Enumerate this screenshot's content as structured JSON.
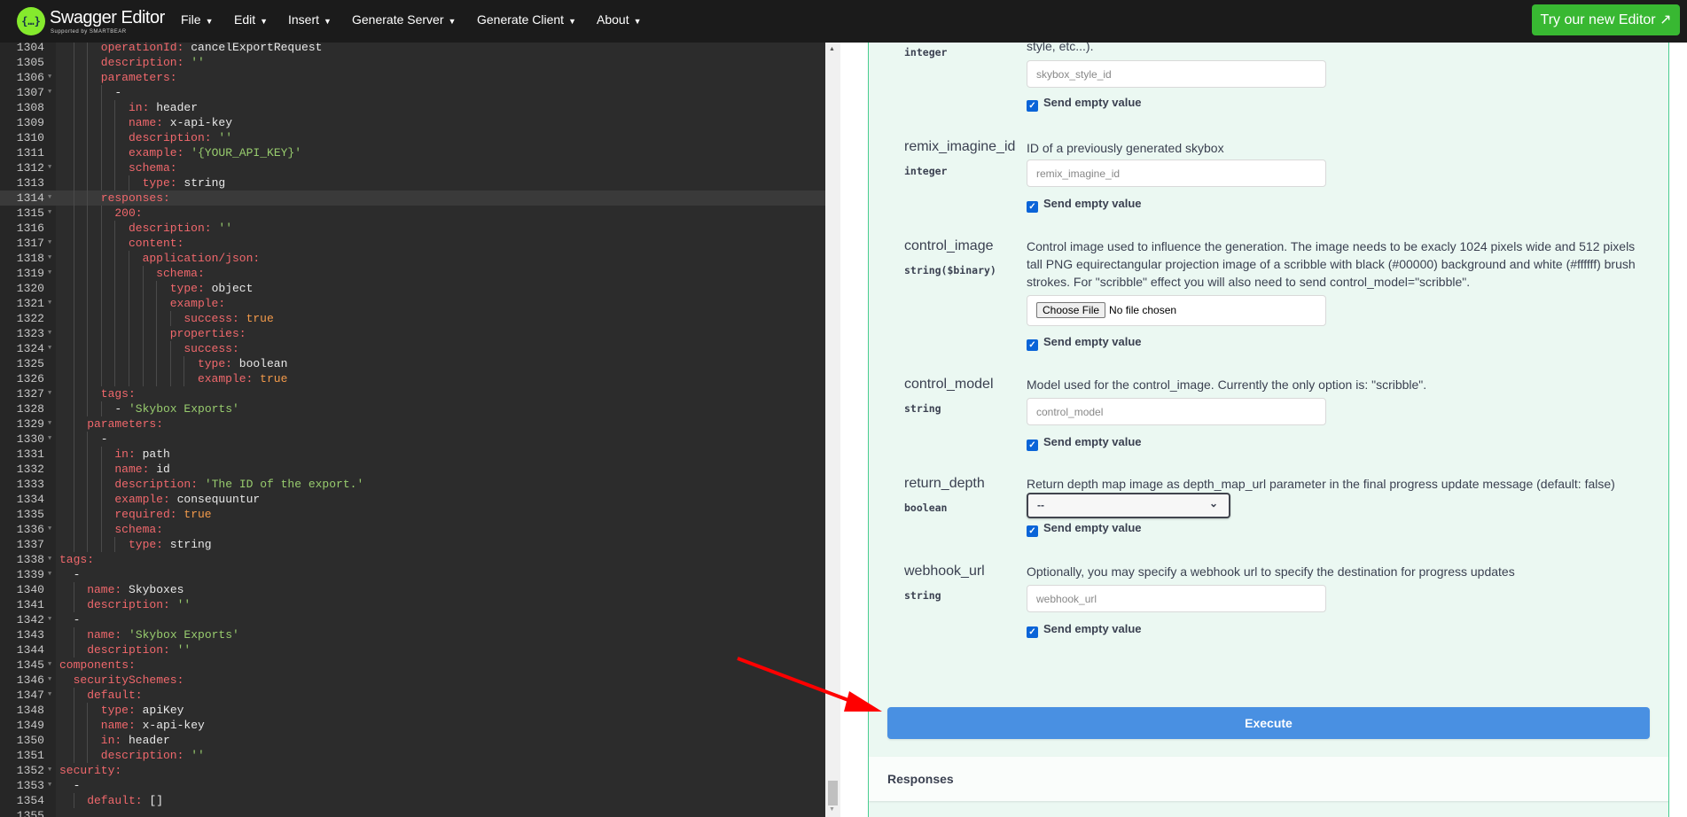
{
  "topbar": {
    "brand": "Swagger Editor",
    "brand_sub": "Supported by SMARTBEAR",
    "logo_glyph": "{…}",
    "menus": [
      "File",
      "Edit",
      "Insert",
      "Generate Server",
      "Generate Client",
      "About"
    ],
    "try_button": "Try our new Editor ↗"
  },
  "editor": {
    "active_line": 1314,
    "folds": [
      1306,
      1307,
      1312,
      1314,
      1315,
      1317,
      1318,
      1319,
      1321,
      1323,
      1324,
      1327,
      1329,
      1330,
      1336,
      1338,
      1339,
      1342,
      1345,
      1346,
      1347,
      1352,
      1353
    ],
    "lines": [
      [
        1304,
        6,
        "operationId: cancelExportRequest"
      ],
      [
        1305,
        6,
        "description: ''"
      ],
      [
        1306,
        6,
        "parameters:"
      ],
      [
        1307,
        8,
        "-"
      ],
      [
        1308,
        10,
        "in: header"
      ],
      [
        1309,
        10,
        "name: x-api-key"
      ],
      [
        1310,
        10,
        "description: ''"
      ],
      [
        1311,
        10,
        "example: '{YOUR_API_KEY}'"
      ],
      [
        1312,
        10,
        "schema:"
      ],
      [
        1313,
        12,
        "type: string"
      ],
      [
        1314,
        6,
        "responses:"
      ],
      [
        1315,
        8,
        "200:"
      ],
      [
        1316,
        10,
        "description: ''"
      ],
      [
        1317,
        10,
        "content:"
      ],
      [
        1318,
        12,
        "application/json:"
      ],
      [
        1319,
        14,
        "schema:"
      ],
      [
        1320,
        16,
        "type: object"
      ],
      [
        1321,
        16,
        "example:"
      ],
      [
        1322,
        18,
        "success: true"
      ],
      [
        1323,
        16,
        "properties:"
      ],
      [
        1324,
        18,
        "success:"
      ],
      [
        1325,
        20,
        "type: boolean"
      ],
      [
        1326,
        20,
        "example: true"
      ],
      [
        1327,
        6,
        "tags:"
      ],
      [
        1328,
        8,
        "- 'Skybox Exports'"
      ],
      [
        1329,
        4,
        "parameters:"
      ],
      [
        1330,
        6,
        "-"
      ],
      [
        1331,
        8,
        "in: path"
      ],
      [
        1332,
        8,
        "name: id"
      ],
      [
        1333,
        8,
        "description: 'The ID of the export.'"
      ],
      [
        1334,
        8,
        "example: consequuntur"
      ],
      [
        1335,
        8,
        "required: true"
      ],
      [
        1336,
        8,
        "schema:"
      ],
      [
        1337,
        10,
        "type: string"
      ],
      [
        1338,
        0,
        "tags:"
      ],
      [
        1339,
        2,
        "-"
      ],
      [
        1340,
        4,
        "name: Skyboxes"
      ],
      [
        1341,
        4,
        "description: ''"
      ],
      [
        1342,
        2,
        "-"
      ],
      [
        1343,
        4,
        "name: 'Skybox Exports'"
      ],
      [
        1344,
        4,
        "description: ''"
      ],
      [
        1345,
        0,
        "components:"
      ],
      [
        1346,
        2,
        "securitySchemes:"
      ],
      [
        1347,
        4,
        "default:"
      ],
      [
        1348,
        6,
        "type: apiKey"
      ],
      [
        1349,
        6,
        "name: x-api-key"
      ],
      [
        1350,
        6,
        "in: header"
      ],
      [
        1351,
        6,
        "description: ''"
      ],
      [
        1352,
        0,
        "security:"
      ],
      [
        1353,
        2,
        "-"
      ],
      [
        1354,
        4,
        "default: []"
      ],
      [
        1355,
        0,
        ""
      ]
    ]
  },
  "panel": {
    "top_desc_tail": "style, etc...).",
    "send_empty_label": "Send empty value",
    "params": [
      {
        "type": "integer",
        "placeholder": "skybox_style_id"
      },
      {
        "name": "remix_imagine_id",
        "type": "integer",
        "desc": "ID of a previously generated skybox",
        "placeholder": "remix_imagine_id"
      },
      {
        "name": "control_image",
        "type": "string($binary)",
        "desc": "Control image used to influence the generation. The image needs to be exacly 1024 pixels wide and 512 pixels tall PNG equirectangular projection image of a scribble with black (#00000) background and white (#ffffff) brush strokes. For \"scribble\" effect you will also need to send control_model=\"scribble\".",
        "file_button": "Choose File",
        "file_status": "No file chosen"
      },
      {
        "name": "control_model",
        "type": "string",
        "desc": "Model used for the control_image. Currently the only option is: \"scribble\".",
        "placeholder": "control_model"
      },
      {
        "name": "return_depth",
        "type": "boolean",
        "desc": "Return depth map image as depth_map_url parameter in the final progress update message (default: false)",
        "selected": "--"
      },
      {
        "name": "webhook_url",
        "type": "string",
        "desc": "Optionally, you may specify a webhook url to specify the destination for progress updates",
        "placeholder": "webhook_url"
      }
    ],
    "execute_label": "Execute",
    "responses_label": "Responses"
  },
  "colors": {
    "accent_green": "#49cc90",
    "execute_blue": "#4990e2",
    "try_green": "#38b832",
    "annotation_arrow": "#ff0000"
  }
}
